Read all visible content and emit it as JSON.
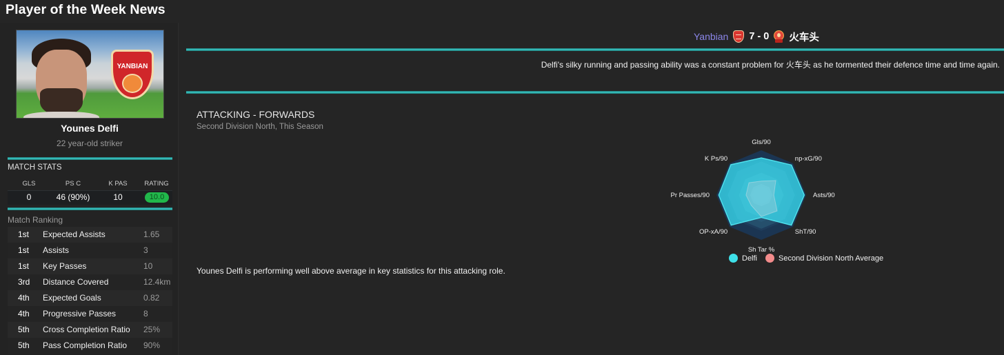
{
  "page_title": "Player of the Week News",
  "player": {
    "name": "Younes Delfi",
    "description": "22 year-old striker",
    "club_crest_text": "YANBIAN"
  },
  "match_stats": {
    "title": "MATCH STATS",
    "headers": [
      "GLS",
      "PS C",
      "K PAS",
      "RATING"
    ],
    "values": [
      "0",
      "46 (90%)",
      "10",
      "10.0"
    ],
    "rating_color": "#21b84b"
  },
  "match_ranking": {
    "title": "Match Ranking",
    "rows": [
      {
        "pos": "1st",
        "label": "Expected Assists",
        "value": "1.65"
      },
      {
        "pos": "1st",
        "label": "Assists",
        "value": "3"
      },
      {
        "pos": "1st",
        "label": "Key Passes",
        "value": "10"
      },
      {
        "pos": "3rd",
        "label": "Distance Covered",
        "value": "12.4km"
      },
      {
        "pos": "4th",
        "label": "Expected Goals",
        "value": "0.82"
      },
      {
        "pos": "4th",
        "label": "Progressive Passes",
        "value": "8"
      },
      {
        "pos": "5th",
        "label": "Cross Completion Ratio",
        "value": "25%"
      },
      {
        "pos": "5th",
        "label": "Pass Completion Ratio",
        "value": "90%"
      }
    ]
  },
  "match": {
    "home_team": "Yanbian",
    "score": "7 - 0",
    "away_team": "火车头",
    "home_color": "#8b86e8",
    "description": "Delfi's silky running and passing ability was a constant problem for 火车头 as he tormented their defence time and time again."
  },
  "analysis": {
    "title": "ATTACKING - FORWARDS",
    "subtitle": "Second Division North, This Season",
    "summary": "Younes Delfi is performing well above average in key statistics for this attacking role."
  },
  "chart_data": {
    "type": "radar",
    "axes": [
      "Gls/90",
      "np-xG/90",
      "Asts/90",
      "ShT/90",
      "Sh Tar %",
      "OP-xA/90",
      "Pr Passes/90",
      "K Ps/90"
    ],
    "range": [
      0,
      1
    ],
    "series": [
      {
        "name": "Delfi",
        "color": "#3ee0e8",
        "values": [
          0.83,
          0.95,
          0.96,
          0.95,
          0.5,
          0.95,
          0.95,
          0.96
        ]
      },
      {
        "name": "Second Division North Average",
        "color": "#f28b8b",
        "values": [
          0.31,
          0.46,
          0.28,
          0.5,
          0.48,
          0.32,
          0.34,
          0.39
        ]
      }
    ],
    "legend_position": "bottom"
  }
}
